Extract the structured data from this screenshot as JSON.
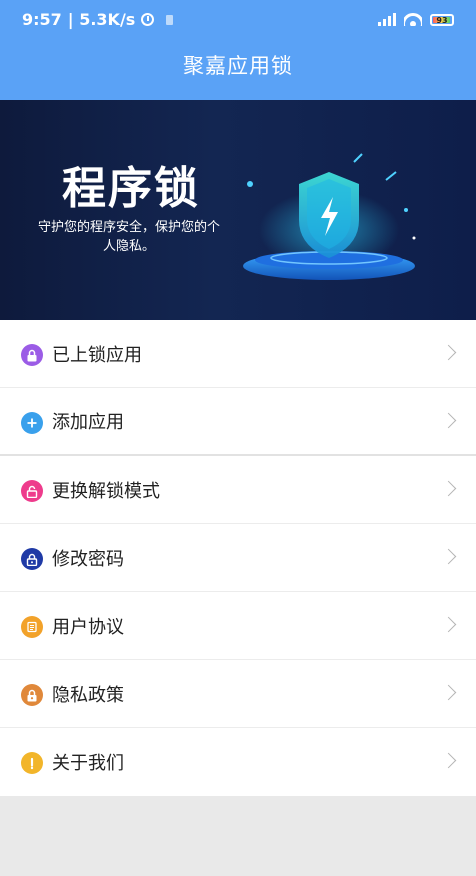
{
  "status_bar": {
    "time": "9:57",
    "speed": "| 5.3K/s",
    "signal_icon": "signal-icon",
    "wifi_icon": "wifi-icon",
    "battery_level": "93"
  },
  "header": {
    "title": "聚嘉应用锁"
  },
  "banner": {
    "title": "程序锁",
    "subtitle": "守护您的程序安全，保护您的个人隐私。"
  },
  "menu": {
    "items": [
      {
        "label": "已上锁应用",
        "icon": "locked-apps-icon",
        "color": "#9b5ce6"
      },
      {
        "label": "添加应用",
        "icon": "add-app-icon",
        "color": "#39a0ec"
      },
      {
        "label": "更换解锁模式",
        "icon": "unlock-mode-icon",
        "color": "#ee3b8c"
      },
      {
        "label": "修改密码",
        "icon": "password-icon",
        "color": "#1f3aa6"
      },
      {
        "label": "用户协议",
        "icon": "agreement-icon",
        "color": "#f2a22a"
      },
      {
        "label": "隐私政策",
        "icon": "privacy-icon",
        "color": "#e0883a"
      },
      {
        "label": "关于我们",
        "icon": "about-icon",
        "color": "#f2b52a"
      }
    ]
  }
}
